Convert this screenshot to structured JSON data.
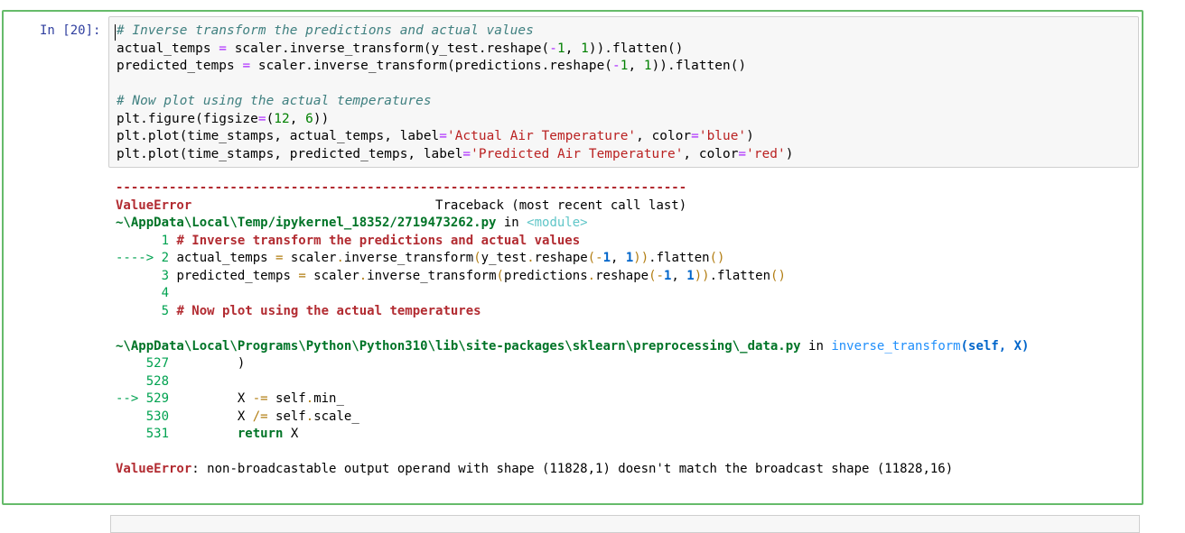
{
  "cell": {
    "prompt": "In [20]:",
    "code_lines": [
      {
        "parts": [
          {
            "t": "# Inverse transform the predictions and actual values",
            "c": "cm"
          }
        ]
      },
      {
        "parts": [
          {
            "t": "actual_temps "
          },
          {
            "t": "=",
            "c": "op"
          },
          {
            "t": " scaler.inverse_transform(y_test.reshape("
          },
          {
            "t": "-",
            "c": "op"
          },
          {
            "t": "1",
            "c": "num"
          },
          {
            "t": ", "
          },
          {
            "t": "1",
            "c": "num"
          },
          {
            "t": ")).flatten()"
          }
        ]
      },
      {
        "parts": [
          {
            "t": "predicted_temps "
          },
          {
            "t": "=",
            "c": "op"
          },
          {
            "t": " scaler.inverse_transform(predictions.reshape("
          },
          {
            "t": "-",
            "c": "op"
          },
          {
            "t": "1",
            "c": "num"
          },
          {
            "t": ", "
          },
          {
            "t": "1",
            "c": "num"
          },
          {
            "t": ")).flatten()"
          }
        ]
      },
      {
        "parts": [
          {
            "t": ""
          }
        ]
      },
      {
        "parts": [
          {
            "t": "# Now plot using the actual temperatures",
            "c": "cm"
          }
        ]
      },
      {
        "parts": [
          {
            "t": "plt.figure(figsize"
          },
          {
            "t": "=",
            "c": "op"
          },
          {
            "t": "("
          },
          {
            "t": "12",
            "c": "num"
          },
          {
            "t": ", "
          },
          {
            "t": "6",
            "c": "num"
          },
          {
            "t": "))"
          }
        ]
      },
      {
        "parts": [
          {
            "t": "plt.plot(time_stamps, actual_temps, label"
          },
          {
            "t": "=",
            "c": "op"
          },
          {
            "t": "'Actual Air Temperature'",
            "c": "str"
          },
          {
            "t": ", color"
          },
          {
            "t": "=",
            "c": "op"
          },
          {
            "t": "'blue'",
            "c": "str"
          },
          {
            "t": ")"
          }
        ]
      },
      {
        "parts": [
          {
            "t": "plt.plot(time_stamps, predicted_temps, label"
          },
          {
            "t": "=",
            "c": "op"
          },
          {
            "t": "'Predicted Air Temperature'",
            "c": "str"
          },
          {
            "t": ", color"
          },
          {
            "t": "=",
            "c": "op"
          },
          {
            "t": "'red'",
            "c": "str"
          },
          {
            "t": ")"
          }
        ]
      }
    ],
    "output_lines": [
      {
        "parts": [
          {
            "t": "---------------------------------------------------------------------------",
            "c": "ansi-red"
          }
        ]
      },
      {
        "parts": [
          {
            "t": "ValueError",
            "c": "ansi-red"
          },
          {
            "t": "                                Traceback (most recent call last)"
          }
        ]
      },
      {
        "parts": [
          {
            "t": "~\\AppData\\Local\\Temp/ipykernel_18352/2719473262.py",
            "c": "ansi-green"
          },
          {
            "t": " in "
          },
          {
            "t": "<module>",
            "c": "ansi-cyan"
          }
        ]
      },
      {
        "parts": [
          {
            "t": "      1",
            "c": "ansi-ln"
          },
          {
            "t": " # Inverse transform the predictions and actual values",
            "c": "ansi-red"
          }
        ]
      },
      {
        "parts": [
          {
            "t": "----> 2",
            "c": "ansi-ln"
          },
          {
            "t": " actual_temps "
          },
          {
            "t": "=",
            "c": "ansi-yel"
          },
          {
            "t": " scaler"
          },
          {
            "t": ".",
            "c": "ansi-yel"
          },
          {
            "t": "inverse_transform"
          },
          {
            "t": "(",
            "c": "ansi-yel"
          },
          {
            "t": "y_test"
          },
          {
            "t": ".",
            "c": "ansi-yel"
          },
          {
            "t": "reshape"
          },
          {
            "t": "(",
            "c": "ansi-yel"
          },
          {
            "t": "-",
            "c": "ansi-yel"
          },
          {
            "t": "1",
            "c": "ansi-blue"
          },
          {
            "t": ", "
          },
          {
            "t": "1",
            "c": "ansi-blue"
          },
          {
            "t": "))",
            "c": "ansi-yel"
          },
          {
            "t": "."
          },
          {
            "t": "flatten"
          },
          {
            "t": "()",
            "c": "ansi-yel"
          }
        ]
      },
      {
        "parts": [
          {
            "t": "      3",
            "c": "ansi-ln"
          },
          {
            "t": " predicted_temps "
          },
          {
            "t": "=",
            "c": "ansi-yel"
          },
          {
            "t": " scaler"
          },
          {
            "t": ".",
            "c": "ansi-yel"
          },
          {
            "t": "inverse_transform"
          },
          {
            "t": "(",
            "c": "ansi-yel"
          },
          {
            "t": "predictions"
          },
          {
            "t": ".",
            "c": "ansi-yel"
          },
          {
            "t": "reshape"
          },
          {
            "t": "(",
            "c": "ansi-yel"
          },
          {
            "t": "-",
            "c": "ansi-yel"
          },
          {
            "t": "1",
            "c": "ansi-blue"
          },
          {
            "t": ", "
          },
          {
            "t": "1",
            "c": "ansi-blue"
          },
          {
            "t": "))",
            "c": "ansi-yel"
          },
          {
            "t": "."
          },
          {
            "t": "flatten"
          },
          {
            "t": "()",
            "c": "ansi-yel"
          }
        ]
      },
      {
        "parts": [
          {
            "t": "      4",
            "c": "ansi-ln"
          }
        ]
      },
      {
        "parts": [
          {
            "t": "      5",
            "c": "ansi-ln"
          },
          {
            "t": " # Now plot using the actual temperatures",
            "c": "ansi-red"
          }
        ]
      },
      {
        "parts": [
          {
            "t": ""
          }
        ]
      },
      {
        "parts": [
          {
            "t": "~\\AppData\\Local\\Programs\\Python\\Python310\\lib\\site-packages\\sklearn\\preprocessing\\_data.py",
            "c": "ansi-green"
          },
          {
            "t": " in "
          },
          {
            "t": "inverse_transform",
            "c": "ansi-plain-blue"
          },
          {
            "t": "(self, X)",
            "c": "ansi-blue"
          }
        ]
      },
      {
        "parts": [
          {
            "t": "    527",
            "c": "ansi-ln"
          },
          {
            "t": "         )"
          }
        ]
      },
      {
        "parts": [
          {
            "t": "    528",
            "c": "ansi-ln"
          }
        ]
      },
      {
        "parts": [
          {
            "t": "--> 529",
            "c": "ansi-ln"
          },
          {
            "t": "         X "
          },
          {
            "t": "-=",
            "c": "ansi-yel"
          },
          {
            "t": " self"
          },
          {
            "t": ".",
            "c": "ansi-yel"
          },
          {
            "t": "min_"
          }
        ]
      },
      {
        "parts": [
          {
            "t": "    530",
            "c": "ansi-ln"
          },
          {
            "t": "         X "
          },
          {
            "t": "/=",
            "c": "ansi-yel"
          },
          {
            "t": " self"
          },
          {
            "t": ".",
            "c": "ansi-yel"
          },
          {
            "t": "scale_"
          }
        ]
      },
      {
        "parts": [
          {
            "t": "    531",
            "c": "ansi-ln"
          },
          {
            "t": "         "
          },
          {
            "t": "return",
            "c": "ansi-green"
          },
          {
            "t": " X"
          }
        ]
      },
      {
        "parts": [
          {
            "t": ""
          }
        ]
      },
      {
        "parts": [
          {
            "t": "ValueError",
            "c": "ansi-red"
          },
          {
            "t": ": non-broadcastable output operand with shape (11828,1) doesn't match the broadcast shape (11828,16)"
          }
        ]
      }
    ]
  }
}
